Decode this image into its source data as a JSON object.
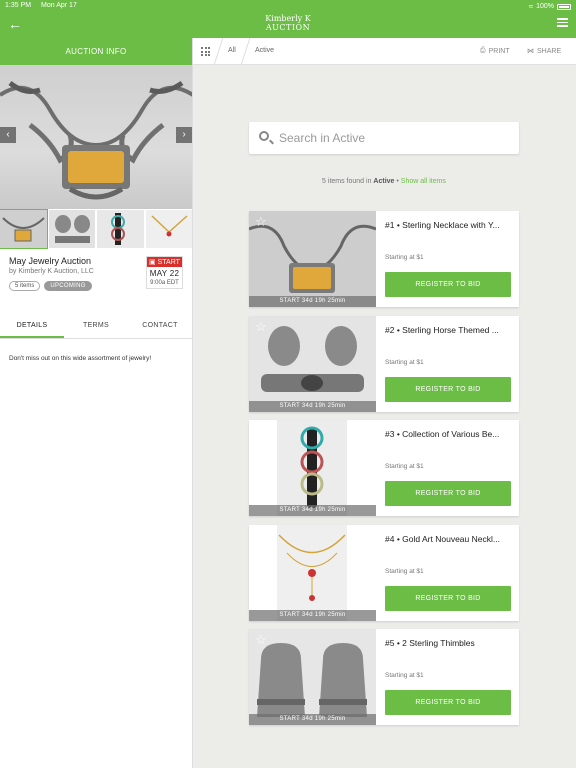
{
  "status_bar": {
    "time": "1:35 PM",
    "date": "Mon Apr 17",
    "battery": "100%"
  },
  "header": {
    "logo_line1": "Kimberly K",
    "logo_line2": "AUCTION"
  },
  "colors": {
    "brand_green": "#6cbd45",
    "start_red": "#d9302c"
  },
  "left": {
    "tab_label": "AUCTION INFO",
    "auction_title": "May Jewelry Auction",
    "auction_by": "by Kimberly K Auction, LLC",
    "item_count": "5 items",
    "status": "UPCOMING",
    "start": {
      "label": "START",
      "date": "MAY 22",
      "time": "9:00a EDT"
    },
    "tabs": [
      "DETAILS",
      "TERMS",
      "CONTACT"
    ],
    "details": "Don't miss out on this wide assortment of jewelry!"
  },
  "subbar": {
    "crumb_all": "All",
    "crumb_active": "Active",
    "print": "PRINT",
    "share": "SHARE"
  },
  "search": {
    "placeholder": "Search in Active"
  },
  "found": {
    "prefix": "5 items found in",
    "scope": "Active",
    "sep": "•",
    "link": "Show all items"
  },
  "items": [
    {
      "title": "#1 • Sterling Necklace with Y...",
      "starting": "Starting at $1",
      "bid": "REGISTER TO BID",
      "timer": "START 34d 19h 25min"
    },
    {
      "title": "#2 • Sterling Horse Themed ...",
      "starting": "Starting at $1",
      "bid": "REGISTER TO BID",
      "timer": "START 34d 19h 25min"
    },
    {
      "title": "#3 • Collection of Various Be...",
      "starting": "Starting at $1",
      "bid": "REGISTER TO BID",
      "timer": "START 34d 19h 25min"
    },
    {
      "title": "#4 • Gold Art Nouveau Neckl...",
      "starting": "Starting at $1",
      "bid": "REGISTER TO BID",
      "timer": "START 34d 19h 25min"
    },
    {
      "title": "#5 • 2 Sterling Thimbles",
      "starting": "Starting at $1",
      "bid": "REGISTER TO BID",
      "timer": "START 34d 19h 25min"
    }
  ]
}
